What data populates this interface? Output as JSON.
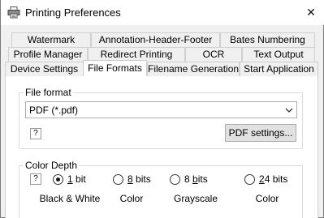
{
  "window": {
    "title": "Printing Preferences",
    "close_glyph": "✕",
    "icon": "printer-icon"
  },
  "tabs": {
    "row1": [
      "Watermark",
      "Annotation-Header-Footer",
      "Bates Numbering"
    ],
    "row2": [
      "Profile Manager",
      "Redirect Printing",
      "OCR",
      "Text Output"
    ],
    "row3": [
      "Device Settings",
      "File Formats",
      "Filename Generation",
      "Start Application"
    ],
    "active": "File Formats"
  },
  "file_format": {
    "group_label": "File format",
    "selected": "PDF (*.pdf)",
    "help": "?",
    "settings_button": "PDF settings..."
  },
  "color_depth": {
    "group_label": "Color Depth",
    "help": "?",
    "options": [
      {
        "prefix": "",
        "key": "1",
        "suffix": " bit",
        "caption": "Black & White",
        "checked": true
      },
      {
        "prefix": "",
        "key": "8",
        "suffix": " bits",
        "caption": "Color",
        "checked": false
      },
      {
        "prefix": "8 ",
        "key": "b",
        "suffix": "its",
        "caption": "Grayscale",
        "checked": false
      },
      {
        "prefix": "",
        "key": "2",
        "suffix": "4 bits",
        "caption": "Color",
        "checked": false
      }
    ]
  }
}
